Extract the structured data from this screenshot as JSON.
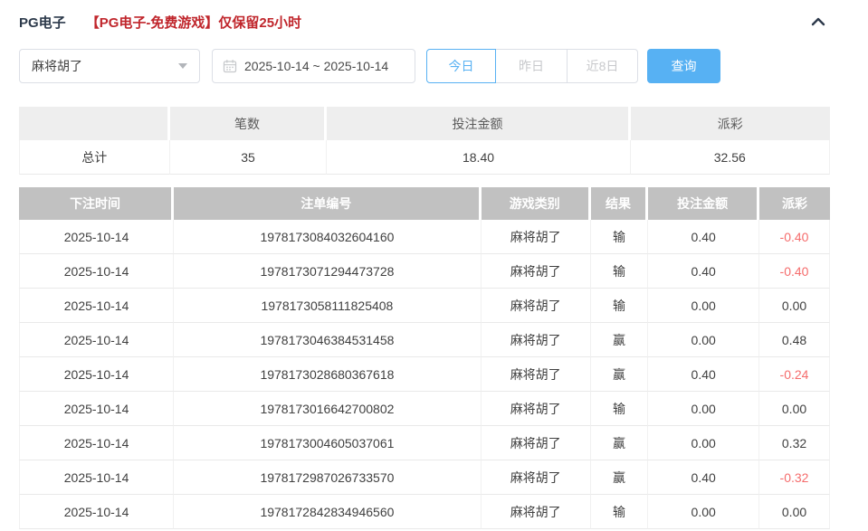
{
  "panel": {
    "title": "PG电子",
    "notice": "【PG电子-免费游戏】仅保留25小时"
  },
  "filters": {
    "game_select": {
      "value": "麻将胡了"
    },
    "date_range": {
      "value": "2025-10-14 ~ 2025-10-14"
    },
    "quick_buttons": [
      {
        "label": "今日",
        "active": true
      },
      {
        "label": "昨日",
        "active": false
      },
      {
        "label": "近8日",
        "active": false
      }
    ],
    "query_label": "查询"
  },
  "summary_table": {
    "headers": [
      "",
      "笔数",
      "投注金额",
      "派彩"
    ],
    "total": {
      "label": "总计",
      "count": "35",
      "bet_amount": "18.40",
      "payout": "32.56"
    }
  },
  "detail_table": {
    "headers": [
      "下注时间",
      "注单编号",
      "游戏类别",
      "结果",
      "投注金额",
      "派彩"
    ],
    "rows": [
      {
        "date": "2025-10-14",
        "order_id": "1978173084032604160",
        "game": "麻将胡了",
        "result": "输",
        "bet": "0.40",
        "payout": "-0.40"
      },
      {
        "date": "2025-10-14",
        "order_id": "1978173071294473728",
        "game": "麻将胡了",
        "result": "输",
        "bet": "0.40",
        "payout": "-0.40"
      },
      {
        "date": "2025-10-14",
        "order_id": "1978173058111825408",
        "game": "麻将胡了",
        "result": "输",
        "bet": "0.00",
        "payout": "0.00"
      },
      {
        "date": "2025-10-14",
        "order_id": "1978173046384531458",
        "game": "麻将胡了",
        "result": "赢",
        "bet": "0.00",
        "payout": "0.48"
      },
      {
        "date": "2025-10-14",
        "order_id": "1978173028680367618",
        "game": "麻将胡了",
        "result": "赢",
        "bet": "0.40",
        "payout": "-0.24"
      },
      {
        "date": "2025-10-14",
        "order_id": "1978173016642700802",
        "game": "麻将胡了",
        "result": "输",
        "bet": "0.00",
        "payout": "0.00"
      },
      {
        "date": "2025-10-14",
        "order_id": "1978173004605037061",
        "game": "麻将胡了",
        "result": "赢",
        "bet": "0.00",
        "payout": "0.32"
      },
      {
        "date": "2025-10-14",
        "order_id": "1978172987026733570",
        "game": "麻将胡了",
        "result": "赢",
        "bet": "0.40",
        "payout": "-0.32"
      },
      {
        "date": "2025-10-14",
        "order_id": "1978172842834946560",
        "game": "麻将胡了",
        "result": "输",
        "bet": "0.00",
        "payout": "0.00"
      }
    ]
  },
  "colors": {
    "accent_blue": "#57b1f3",
    "title_navy": "#2d3a4b",
    "notice_red": "#c0262c",
    "negative_red": "#f56c6c",
    "detail_header_bg": "#c1c1c1",
    "summary_header_bg": "#eeeeee"
  }
}
